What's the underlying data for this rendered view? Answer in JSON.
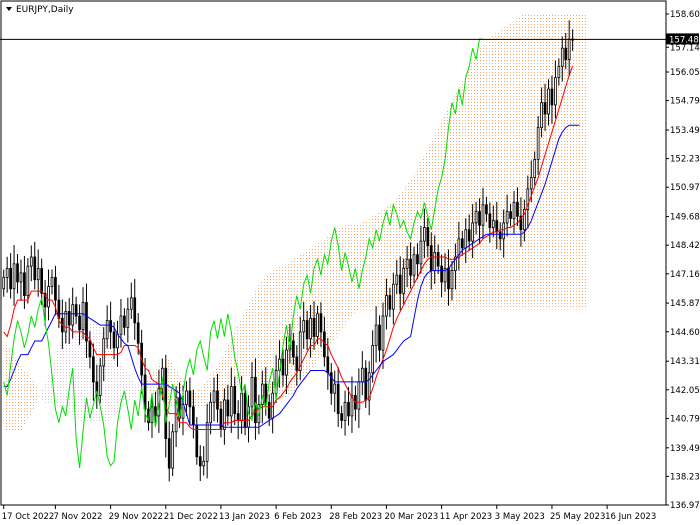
{
  "window": {
    "title": "EURJPY,Daily",
    "menu_icon": "triangle-down-icon"
  },
  "colors": {
    "background": "#ffffff",
    "candle": "#000000",
    "tenkan": "#ff0000",
    "kijun": "#0000ff",
    "chikou": "#00dd00",
    "kumo": "#f4a460",
    "kumo_alt": "#d8bfd8",
    "price_line": "#000000",
    "badge": "#000000"
  },
  "chart_data": {
    "type": "candlestick",
    "symbol": "EURJPY",
    "timeframe": "Daily",
    "indicators": [
      "Ichimoku Kinko Hyo"
    ],
    "current_price": 157.486,
    "current_price_label": "157.486",
    "ylim": [
      136.975,
      158.605
    ],
    "y_ticks": [
      "158.605",
      "157.140",
      "156.050",
      "154.790",
      "153.495",
      "152.235",
      "150.975",
      "149.680",
      "148.420",
      "147.160",
      "145.870",
      "144.605",
      "143.310",
      "142.050",
      "140.790",
      "139.495",
      "138.235",
      "136.975"
    ],
    "x_ticks": [
      "17 Oct 2022",
      "7 Nov 2022",
      "29 Nov 2022",
      "21 Dec 2022",
      "13 Jan 2023",
      "6 Feb 2023",
      "28 Feb 2023",
      "20 Mar 2023",
      "11 Apr 2023",
      "3 May 2023",
      "25 May 2023",
      "16 Jun 2023"
    ],
    "x_tick_index": [
      0,
      15,
      31,
      47,
      63,
      79,
      95,
      111,
      127,
      143,
      159,
      175
    ],
    "close": [
      147.0,
      147.4,
      146.5,
      147.6,
      146.8,
      147.2,
      146.2,
      147.5,
      147.9,
      146.9,
      147.4,
      146.3,
      145.7,
      146.6,
      147.0,
      146.0,
      145.2,
      144.6,
      145.5,
      144.9,
      145.8,
      145.3,
      144.7,
      145.9,
      144.2,
      143.5,
      142.4,
      141.8,
      143.1,
      144.3,
      145.1,
      144.6,
      143.9,
      144.5,
      145.3,
      144.8,
      145.6,
      146.1,
      145.0,
      144.1,
      142.7,
      141.2,
      140.6,
      141.3,
      140.9,
      142.1,
      143.0,
      139.9,
      138.6,
      140.2,
      141.7,
      140.8,
      141.4,
      142.0,
      141.3,
      140.5,
      139.1,
      138.7,
      138.9,
      140.6,
      141.5,
      142.0,
      141.2,
      140.3,
      141.6,
      140.9,
      142.2,
      141.0,
      140.7,
      141.9,
      140.4,
      141.3,
      142.6,
      140.6,
      141.4,
      142.3,
      141.5,
      140.8,
      141.9,
      142.9,
      143.4,
      142.7,
      143.8,
      144.2,
      143.5,
      142.9,
      144.6,
      145.1,
      144.3,
      145.2,
      144.4,
      145.4,
      144.6,
      143.5,
      142.8,
      141.9,
      142.3,
      141.0,
      140.7,
      141.5,
      140.9,
      141.8,
      141.2,
      142.4,
      143.0,
      141.6,
      142.8,
      144.0,
      144.9,
      143.8,
      145.3,
      146.2,
      145.6,
      146.7,
      147.1,
      146.3,
      147.4,
      147.8,
      147.1,
      148.0,
      147.6,
      148.6,
      149.2,
      148.4,
      147.3,
      148.1,
      147.5,
      146.8,
      147.4,
      146.5,
      147.3,
      147.9,
      148.7,
      148.3,
      149.1,
      148.6,
      149.4,
      149.9,
      149.3,
      150.2,
      149.8,
      149.2,
      149.5,
      149.0,
      148.7,
      149.4,
      149.9,
      149.6,
      150.3,
      149.7,
      149.1,
      150.0,
      150.9,
      151.4,
      152.2,
      153.6,
      154.7,
      154.2,
      155.3,
      154.6,
      155.8,
      156.3,
      157.1,
      156.6,
      157.5,
      157.486
    ],
    "open": [
      146.5,
      147.0,
      147.4,
      146.5,
      147.6,
      146.8,
      147.2,
      146.2,
      147.5,
      147.9,
      146.9,
      147.4,
      146.3,
      145.7,
      146.6,
      147.0,
      146.0,
      145.2,
      144.6,
      145.5,
      144.9,
      145.8,
      145.3,
      144.7,
      145.9,
      144.2,
      143.5,
      142.4,
      141.8,
      143.1,
      144.3,
      145.1,
      144.6,
      143.9,
      144.5,
      145.3,
      144.8,
      145.6,
      146.1,
      145.0,
      144.1,
      142.7,
      141.2,
      140.6,
      141.3,
      140.9,
      142.1,
      143.0,
      139.9,
      138.6,
      140.2,
      141.7,
      140.8,
      141.4,
      142.0,
      141.3,
      140.5,
      139.1,
      138.7,
      138.9,
      140.6,
      141.5,
      142.0,
      141.2,
      140.3,
      141.6,
      140.9,
      142.2,
      141.0,
      140.7,
      141.9,
      140.4,
      141.3,
      142.6,
      140.6,
      141.4,
      142.3,
      141.5,
      140.8,
      141.9,
      142.9,
      143.4,
      142.7,
      143.8,
      144.2,
      143.5,
      142.9,
      144.6,
      145.1,
      144.3,
      145.2,
      144.4,
      145.4,
      144.6,
      143.5,
      142.8,
      141.9,
      142.3,
      141.0,
      140.7,
      141.5,
      140.9,
      141.8,
      141.2,
      142.4,
      143.0,
      141.6,
      142.8,
      144.0,
      144.9,
      143.8,
      145.3,
      146.2,
      145.6,
      146.7,
      147.1,
      146.3,
      147.4,
      147.8,
      147.1,
      148.0,
      147.6,
      148.6,
      149.2,
      148.4,
      147.3,
      148.1,
      147.5,
      146.8,
      147.4,
      146.5,
      147.3,
      147.9,
      148.7,
      148.3,
      149.1,
      148.6,
      149.4,
      149.9,
      149.3,
      150.2,
      149.8,
      149.2,
      149.5,
      149.0,
      148.7,
      149.4,
      149.9,
      149.6,
      150.3,
      149.7,
      149.1,
      150.0,
      150.9,
      151.4,
      152.2,
      153.6,
      154.7,
      154.2,
      155.3,
      154.6,
      155.8,
      156.3,
      157.1,
      156.6,
      157.5
    ],
    "tenkan": [
      144.6,
      144.4,
      144.9,
      145.6,
      146.0,
      146.0,
      146.0,
      146.0,
      146.4,
      146.4,
      146.4,
      146.4,
      146.2,
      146.0,
      146.0,
      145.7,
      145.1,
      144.9,
      144.8,
      144.8,
      144.6,
      144.6,
      144.6,
      144.6,
      144.4,
      144.3,
      143.9,
      143.6,
      143.6,
      143.6,
      143.6,
      143.6,
      143.6,
      143.6,
      143.7,
      144.0,
      144.0,
      144.0,
      144.0,
      143.9,
      143.4,
      143.0,
      142.9,
      142.5,
      142.4,
      142.3,
      141.8,
      141.3,
      141.0,
      141.0,
      141.0,
      140.6,
      140.6,
      140.6,
      140.4,
      140.3,
      140.3,
      140.3,
      140.3,
      140.3,
      140.3,
      140.3,
      140.3,
      140.3,
      140.6,
      140.6,
      140.6,
      140.7,
      140.7,
      140.7,
      140.7,
      140.7,
      140.9,
      141.1,
      141.2,
      141.3,
      141.3,
      141.3,
      141.3,
      141.6,
      141.7,
      141.9,
      142.1,
      142.4,
      142.6,
      142.8,
      143.1,
      143.4,
      143.7,
      144.0,
      144.0,
      144.3,
      144.3,
      144.1,
      144.0,
      143.6,
      143.3,
      143.0,
      142.6,
      142.3,
      142.0,
      141.7,
      141.5,
      141.5,
      141.5,
      141.6,
      141.7,
      142.1,
      142.6,
      143.0,
      143.4,
      143.8,
      144.3,
      144.8,
      145.2,
      145.5,
      145.8,
      146.1,
      146.4,
      146.7,
      147.0,
      147.3,
      147.6,
      147.8,
      147.9,
      147.9,
      147.9,
      147.9,
      147.9,
      147.8,
      147.8,
      147.8,
      147.9,
      148.0,
      148.1,
      148.2,
      148.3,
      148.4,
      148.5,
      148.7,
      148.8,
      148.9,
      149.0,
      149.0,
      149.1,
      149.1,
      149.2,
      149.2,
      149.3,
      149.4,
      149.6,
      149.8,
      150.2,
      150.6,
      151.0,
      151.4,
      151.9,
      152.4,
      152.9,
      153.4,
      153.9,
      154.4,
      154.9,
      155.4,
      155.9,
      156.3
    ],
    "kijun": [
      142.2,
      142.2,
      142.5,
      142.9,
      143.3,
      143.6,
      143.6,
      143.6,
      143.9,
      144.2,
      144.2,
      144.2,
      144.5,
      144.8,
      145.1,
      145.4,
      145.4,
      145.4,
      145.4,
      145.4,
      145.4,
      145.4,
      145.4,
      145.4,
      145.3,
      145.2,
      145.1,
      145.0,
      144.9,
      144.9,
      144.9,
      144.9,
      144.8,
      144.5,
      144.3,
      144.1,
      144.0,
      143.5,
      143.0,
      142.6,
      142.3,
      142.3,
      142.3,
      142.3,
      142.3,
      142.3,
      142.3,
      142.3,
      142.2,
      142.1,
      142.0,
      141.9,
      141.5,
      141.0,
      140.5,
      140.5,
      140.5,
      140.5,
      140.5,
      140.5,
      140.5,
      140.5,
      140.5,
      140.5,
      140.4,
      140.4,
      140.4,
      140.4,
      140.4,
      140.4,
      140.4,
      140.4,
      140.4,
      140.4,
      140.4,
      140.5,
      140.6,
      140.7,
      140.8,
      140.9,
      141.0,
      141.2,
      141.4,
      141.6,
      141.8,
      142.1,
      142.3,
      142.5,
      142.7,
      142.9,
      142.9,
      142.9,
      142.9,
      142.9,
      142.8,
      142.6,
      142.4,
      142.4,
      142.4,
      142.4,
      142.4,
      142.4,
      142.4,
      142.4,
      142.4,
      142.4,
      142.5,
      142.7,
      142.9,
      143.1,
      143.3,
      143.4,
      143.5,
      143.6,
      143.8,
      144.0,
      144.2,
      144.3,
      144.4,
      145.2,
      146.0,
      146.6,
      147.0,
      147.2,
      147.3,
      147.3,
      147.3,
      147.3,
      147.3,
      147.4,
      147.6,
      147.8,
      148.0,
      148.2,
      148.3,
      148.4,
      148.5,
      148.6,
      148.7,
      148.8,
      148.9,
      148.9,
      148.9,
      148.9,
      148.9,
      148.9,
      148.9,
      148.9,
      148.9,
      148.9,
      148.9,
      149.0,
      149.2,
      149.5,
      149.9,
      150.3,
      150.7,
      151.1,
      151.6,
      152.1,
      152.6,
      153.1,
      153.4,
      153.6,
      153.7,
      153.7,
      153.7,
      153.7
    ],
    "chikou_offset": -26,
    "kumo_offset": 26,
    "senkou_a": [
      144.2,
      144.1,
      143.9,
      143.6,
      143.3,
      143.1,
      142.9,
      142.8,
      142.6,
      142.4,
      142.0,
      141.6,
      141.4,
      141.4,
      141.4,
      141.4,
      141.3,
      141.2,
      141.1,
      141.0,
      140.9,
      140.8,
      140.7,
      140.6,
      140.6,
      140.6,
      140.6,
      140.6,
      140.6,
      140.6,
      140.6,
      140.7,
      140.8,
      141.0,
      141.2,
      141.4,
      141.5,
      141.6,
      141.7,
      141.9,
      142.1,
      142.3,
      142.6,
      142.8,
      143.0,
      143.2,
      143.3,
      143.4,
      143.4,
      143.2,
      142.9,
      142.7,
      142.5,
      142.3,
      142.1,
      142.0,
      142.0,
      142.1,
      142.3,
      142.5,
      142.7,
      142.9,
      143.1,
      143.4,
      143.7,
      144.0,
      144.3,
      144.6,
      144.9,
      145.2,
      145.5,
      145.8,
      146.1,
      146.4,
      146.7,
      146.9,
      147.1,
      147.2,
      147.3,
      147.4,
      147.5,
      147.5,
      147.6,
      147.7,
      147.8,
      147.9,
      148.0,
      148.1,
      148.2,
      148.3,
      148.4,
      148.5,
      148.6,
      148.7,
      148.8,
      148.9,
      149.0,
      149.1,
      149.2,
      149.3,
      149.3,
      149.3,
      149.3,
      149.3,
      149.4,
      149.5,
      149.6,
      149.7,
      149.8,
      149.9,
      150.0,
      150.1,
      150.2,
      150.3,
      150.5,
      150.7,
      150.9,
      151.1,
      151.3,
      151.5,
      151.8,
      152.1,
      152.4,
      152.7,
      153.0,
      153.3,
      153.6,
      153.9,
      154.2,
      154.5,
      154.8,
      155.1,
      155.4,
      155.7,
      156.0,
      156.3,
      156.6,
      156.9,
      157.1,
      157.3,
      157.5,
      157.6,
      157.7,
      157.8,
      157.9,
      158.0,
      158.1,
      158.2,
      158.3,
      158.4,
      158.5,
      158.6,
      158.6,
      158.6,
      158.6,
      158.6,
      158.6,
      158.6,
      158.6,
      158.6,
      158.6,
      158.6,
      158.6,
      158.6,
      158.6,
      158.6,
      158.6,
      158.6,
      158.6,
      158.6,
      158.6,
      158.6
    ],
    "senkou_b": [
      140.2,
      140.2,
      140.2,
      140.2,
      140.2,
      140.2,
      140.5,
      140.8,
      141.0,
      141.3,
      141.6,
      142.0,
      142.4,
      142.8,
      143.2,
      143.6,
      144.0,
      144.2,
      144.4,
      144.6,
      144.8,
      145.0,
      145.0,
      145.0,
      145.0,
      145.0,
      145.0,
      145.0,
      144.8,
      144.5,
      144.2,
      143.9,
      143.6,
      143.4,
      143.2,
      143.0,
      142.8,
      142.6,
      142.4,
      142.3,
      142.2,
      142.1,
      142.0,
      141.9,
      141.8,
      141.7,
      141.6,
      141.5,
      141.4,
      141.3,
      141.3,
      141.3,
      141.3,
      141.3,
      141.3,
      141.3,
      141.3,
      141.3,
      141.3,
      141.3,
      141.3,
      141.3,
      141.3,
      141.3,
      141.5,
      141.7,
      141.9,
      142.1,
      142.3,
      142.5,
      142.6,
      142.6,
      142.6,
      142.6,
      142.5,
      142.3,
      142.1,
      141.9,
      141.8,
      141.7,
      141.7,
      141.7,
      141.7,
      141.8,
      141.9,
      142.1,
      142.3,
      142.5,
      142.7,
      142.9,
      143.1,
      143.3,
      143.5,
      143.7,
      143.9,
      144.1,
      144.3,
      144.5,
      144.7,
      144.9,
      145.1,
      145.3,
      145.5,
      145.6,
      145.6,
      145.6,
      145.6,
      145.6,
      145.6,
      145.6,
      145.6,
      145.6,
      145.6,
      145.6,
      145.6,
      145.6,
      145.6,
      145.6,
      145.6,
      145.6,
      145.6,
      145.6,
      145.6,
      145.6,
      145.6,
      145.6,
      145.6,
      145.6,
      145.6,
      145.6,
      145.6,
      145.6,
      145.6,
      145.6,
      145.6,
      145.6,
      145.6,
      145.6,
      145.6,
      145.6,
      145.6,
      145.6,
      145.6,
      145.6,
      145.6,
      145.6,
      145.6,
      145.6,
      145.6,
      145.6,
      145.6,
      145.6,
      145.6,
      145.6,
      145.6,
      145.6,
      145.6,
      145.6,
      145.6,
      145.6,
      145.6,
      145.6,
      145.6,
      145.6,
      145.6,
      145.6,
      145.6,
      145.6,
      145.6,
      145.6
    ],
    "grid": false,
    "legend": "none"
  }
}
